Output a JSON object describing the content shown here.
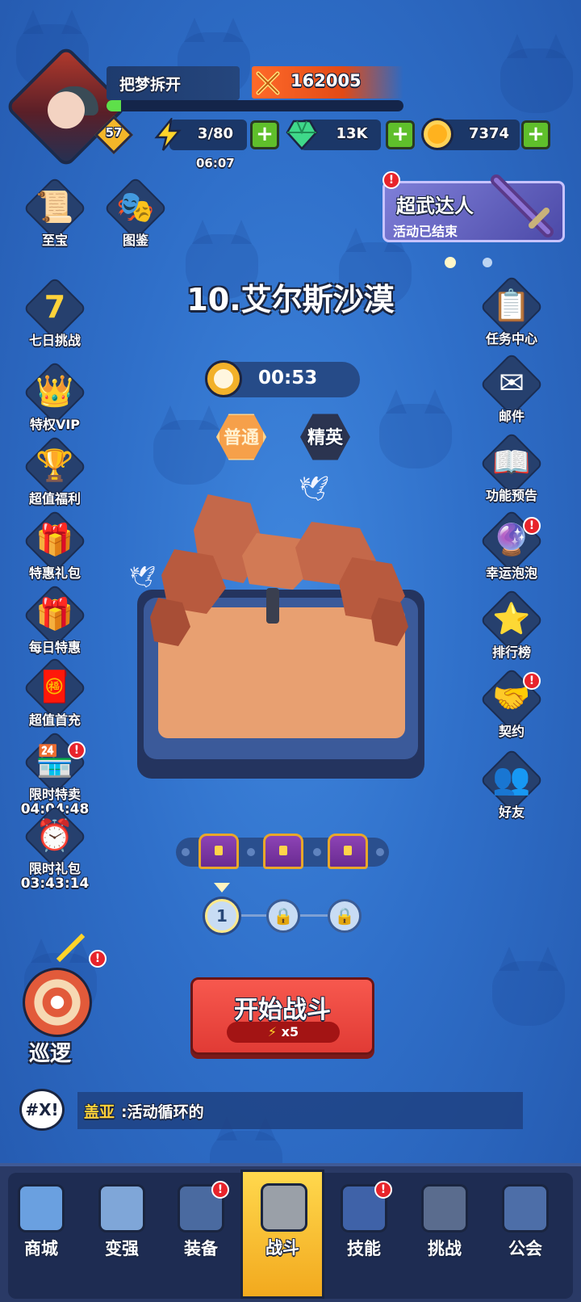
{
  "player": {
    "name": "把梦拆开",
    "level": "57",
    "power": "162005",
    "xp_fraction": 0.05
  },
  "resources": {
    "energy": "3/80",
    "energy_timer": "06:07",
    "gems": "13K",
    "gold": "7374",
    "plus": "+"
  },
  "event": {
    "title": "超武达人",
    "status": "活动已结束",
    "alert": "!"
  },
  "left_menu": [
    {
      "label": "至宝",
      "icon": "scroll-icon"
    },
    {
      "label": "图鉴",
      "icon": "codex-icon"
    },
    {
      "label": "七日挑战",
      "icon": "seven-day-icon"
    },
    {
      "label": "特权VIP",
      "icon": "crown-icon"
    },
    {
      "label": "超值福利",
      "icon": "treasure-icon"
    },
    {
      "label": "特惠礼包",
      "icon": "gift-icon"
    },
    {
      "label": "每日特惠",
      "icon": "gift-blue-icon"
    },
    {
      "label": "超值首充",
      "icon": "first-charge-icon"
    },
    {
      "label": "限时特卖",
      "timer": "04:04:48",
      "icon": "shop-sign-icon"
    },
    {
      "label": "限时礼包",
      "timer": "03:43:14",
      "icon": "timed-gift-icon"
    }
  ],
  "right_menu": [
    {
      "label": "任务中心",
      "icon": "quest-scroll-icon"
    },
    {
      "label": "邮件",
      "icon": "mail-icon"
    },
    {
      "label": "功能预告",
      "icon": "book-icon"
    },
    {
      "label": "幸运泡泡",
      "icon": "bubble-icon"
    },
    {
      "label": "排行榜",
      "icon": "trophy-icon"
    },
    {
      "label": "契约",
      "icon": "handshake-icon"
    },
    {
      "label": "好友",
      "icon": "friends-icon"
    }
  ],
  "stage": {
    "title": "10.艾尔斯沙漠",
    "countdown": "00:53",
    "mode_normal": "普通",
    "mode_elite": "精英",
    "current_node": "1"
  },
  "fight": {
    "label": "开始战斗",
    "cost": "x5"
  },
  "patrol": {
    "label": "巡逻"
  },
  "chat": {
    "icon_text": "#X!",
    "sender": "盖亚",
    "message": ":活动循环的"
  },
  "nav": [
    {
      "label": "商城",
      "icon": "shop-icon"
    },
    {
      "label": "变强",
      "icon": "chest-upgrade-icon"
    },
    {
      "label": "装备",
      "icon": "equipment-icon"
    },
    {
      "label": "战斗",
      "icon": "crossed-swords-icon"
    },
    {
      "label": "技能",
      "icon": "spellbook-icon"
    },
    {
      "label": "挑战",
      "icon": "gate-icon"
    },
    {
      "label": "公会",
      "icon": "guild-shield-icon"
    }
  ]
}
